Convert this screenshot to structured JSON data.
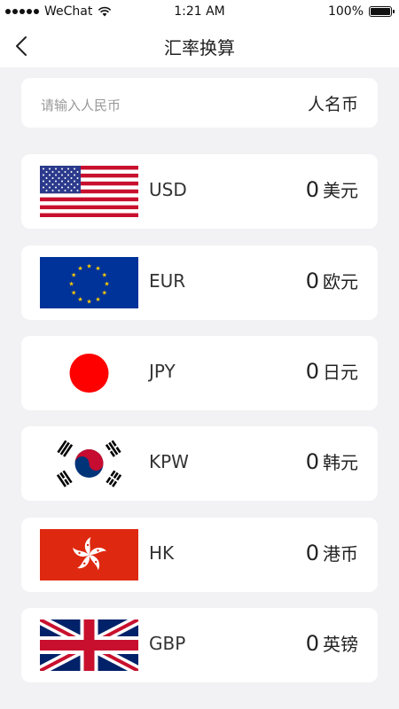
{
  "status_bar": {
    "carrier": "WeChat",
    "time": "1:21 AM",
    "battery": "100%"
  },
  "nav": {
    "title": "汇率换算",
    "back_icon": "chevron-left-icon"
  },
  "input": {
    "placeholder": "请输入人民币",
    "currency": "人名币"
  },
  "currencies": [
    {
      "code": "USD",
      "amount": "0",
      "unit": "美元",
      "flag": "us-flag-icon"
    },
    {
      "code": "EUR",
      "amount": "0",
      "unit": "欧元",
      "flag": "eu-flag-icon"
    },
    {
      "code": "JPY",
      "amount": "0",
      "unit": "日元",
      "flag": "jp-flag-icon"
    },
    {
      "code": "KPW",
      "amount": "0",
      "unit": "韩元",
      "flag": "kr-flag-icon"
    },
    {
      "code": "HK",
      "amount": "0",
      "unit": "港币",
      "flag": "hk-flag-icon"
    },
    {
      "code": "GBP",
      "amount": "0",
      "unit": "英镑",
      "flag": "gb-flag-icon"
    }
  ],
  "colors": {
    "background": "#f2f2f4",
    "card": "#ffffff",
    "placeholder": "#999999",
    "text": "#222222"
  }
}
